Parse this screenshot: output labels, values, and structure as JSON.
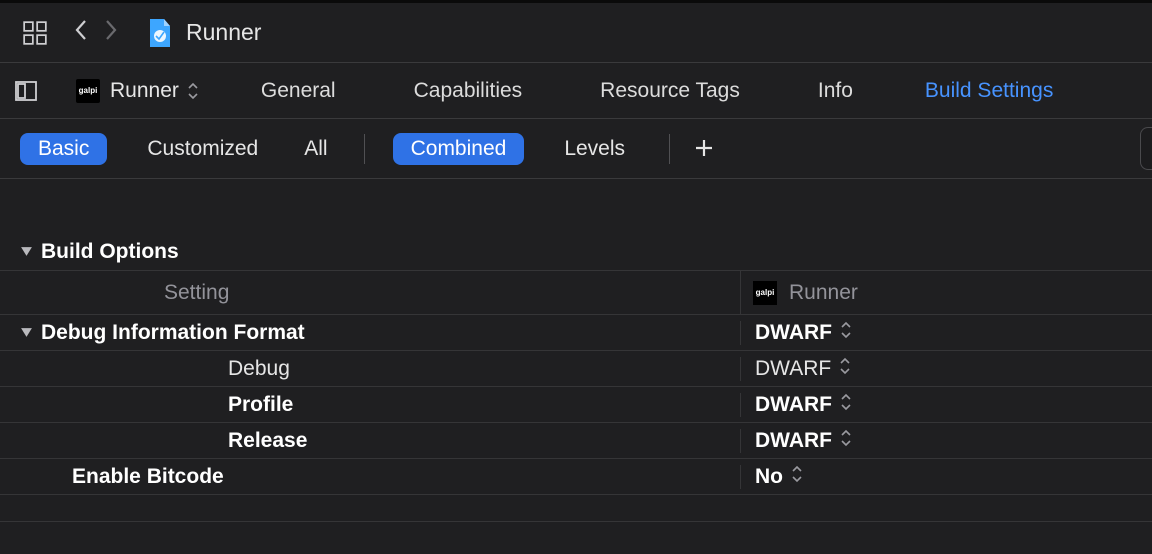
{
  "nav": {
    "title": "Runner"
  },
  "target": {
    "name": "Runner"
  },
  "tabs": {
    "general": "General",
    "capabilities": "Capabilities",
    "resource_tags": "Resource Tags",
    "info": "Info",
    "build_settings": "Build Settings",
    "active": "build_settings"
  },
  "filters": {
    "basic": "Basic",
    "customized": "Customized",
    "all": "All",
    "combined": "Combined",
    "levels": "Levels"
  },
  "columns": {
    "setting": "Setting",
    "target": "Runner"
  },
  "section": {
    "build_options": "Build Options"
  },
  "settings": {
    "debug_info_format": {
      "label": "Debug Information Format",
      "value": "DWARF",
      "children": {
        "debug": {
          "label": "Debug",
          "value": "DWARF"
        },
        "profile": {
          "label": "Profile",
          "value": "DWARF"
        },
        "release": {
          "label": "Release",
          "value": "DWARF"
        }
      }
    },
    "enable_bitcode": {
      "label": "Enable Bitcode",
      "value": "No"
    }
  }
}
